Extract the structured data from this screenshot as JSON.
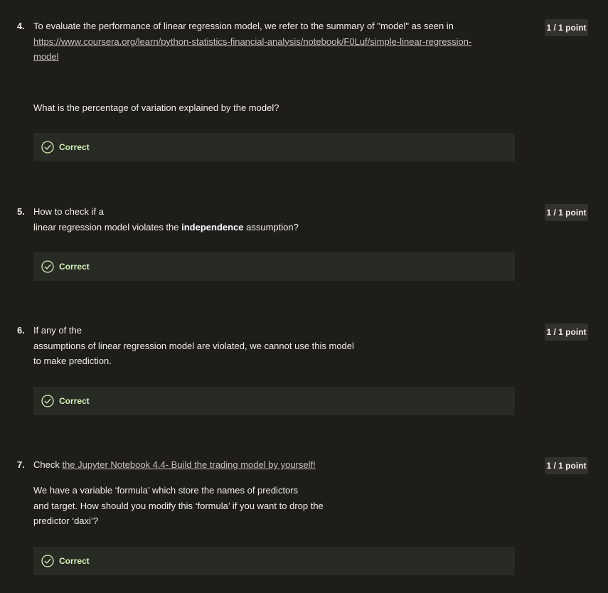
{
  "questions": [
    {
      "number": "4.",
      "line1": "To evaluate the performance of linear regression model, we refer to the summary of \"model\" as seen in",
      "link_line1": "https://www.coursera.org/learn/python-statistics-financial-analysis/notebook/F0Luf/simple-linear-regression-",
      "link_line2": "model",
      "prompt": "What is the percentage of variation explained by the model?",
      "points": "1 / 1 point",
      "result": "Correct"
    },
    {
      "number": "5.",
      "line1": "How to check if a",
      "line2_pre": "linear regression model violates the ",
      "line2_bold": "independence",
      "line2_post": " assumption?",
      "points": "1 / 1 point",
      "result": "Correct"
    },
    {
      "number": "6.",
      "line1": "If any of the",
      "line2": "assumptions of linear regression model are violated, we cannot use this model",
      "line3": "to make prediction.",
      "points": "1 / 1 point",
      "result": "Correct"
    },
    {
      "number": "7.",
      "line1_pre": "Check ",
      "line1_link": "the Jupyter Notebook 4.4- Build the trading model by yourself!",
      "para1": "We have a variable ‘formula’ which store the names of predictors",
      "para2": "and target. How should you modify this ‘formula’ if you want to drop the",
      "para3": "predictor ‘daxi’?",
      "points": "1 / 1 point",
      "result": "Correct"
    }
  ],
  "icons": {
    "correct": "check-circle-icon"
  },
  "colors": {
    "background": "#1f1d1a",
    "text": "#f1efe6",
    "link": "#c7c4bb",
    "correct_box": "#282a24",
    "correct_text": "#d4f2b8",
    "points_badge": "#33312d"
  }
}
